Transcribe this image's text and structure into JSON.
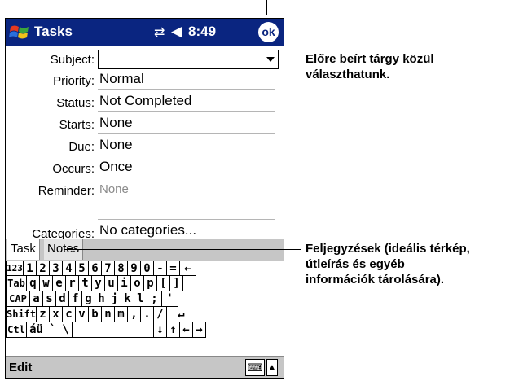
{
  "titlebar": {
    "app_title": "Tasks",
    "clock": "8:49",
    "ok_label": "ok",
    "icons": [
      "windows-start-icon",
      "connectivity-icon",
      "volume-icon"
    ]
  },
  "form": {
    "subject_label": "Subject:",
    "subject_value": "",
    "priority_label": "Priority:",
    "priority_value": "Normal",
    "status_label": "Status:",
    "status_value": "Not Completed",
    "starts_label": "Starts:",
    "starts_value": "None",
    "due_label": "Due:",
    "due_value": "None",
    "occurs_label": "Occurs:",
    "occurs_value": "Once",
    "reminder_label": "Reminder:",
    "reminder_value": "None",
    "categories_label": "Categories:",
    "categories_value": "No categories..."
  },
  "tabs": {
    "task": "Task",
    "notes": "Notes"
  },
  "keyboard": {
    "rows": [
      [
        "123",
        "1",
        "2",
        "3",
        "4",
        "5",
        "6",
        "7",
        "8",
        "9",
        "0",
        "-",
        "=",
        "←"
      ],
      [
        "Tab",
        "q",
        "w",
        "e",
        "r",
        "t",
        "y",
        "u",
        "i",
        "o",
        "p",
        "[",
        "]"
      ],
      [
        "CAP",
        "a",
        "s",
        "d",
        "f",
        "g",
        "h",
        "j",
        "k",
        "l",
        ";",
        "'"
      ],
      [
        "Shift",
        "z",
        "x",
        "c",
        "v",
        "b",
        "n",
        "m",
        ",",
        ".",
        "/",
        "↵"
      ],
      [
        "Ctl",
        "áü",
        "`",
        "\\",
        "",
        "↓",
        "↑",
        "←",
        "→"
      ]
    ]
  },
  "menubar": {
    "edit": "Edit",
    "sip_icon": "keyboard-icon",
    "sip_arrow": "▲"
  },
  "callouts": {
    "subject_note": "Előre beírt tárgy közül\nválaszthatunk.",
    "notes_note": "Feljegyzések (ideális térkép,\nútleírás és egyéb\ninformációk tárolására)."
  }
}
